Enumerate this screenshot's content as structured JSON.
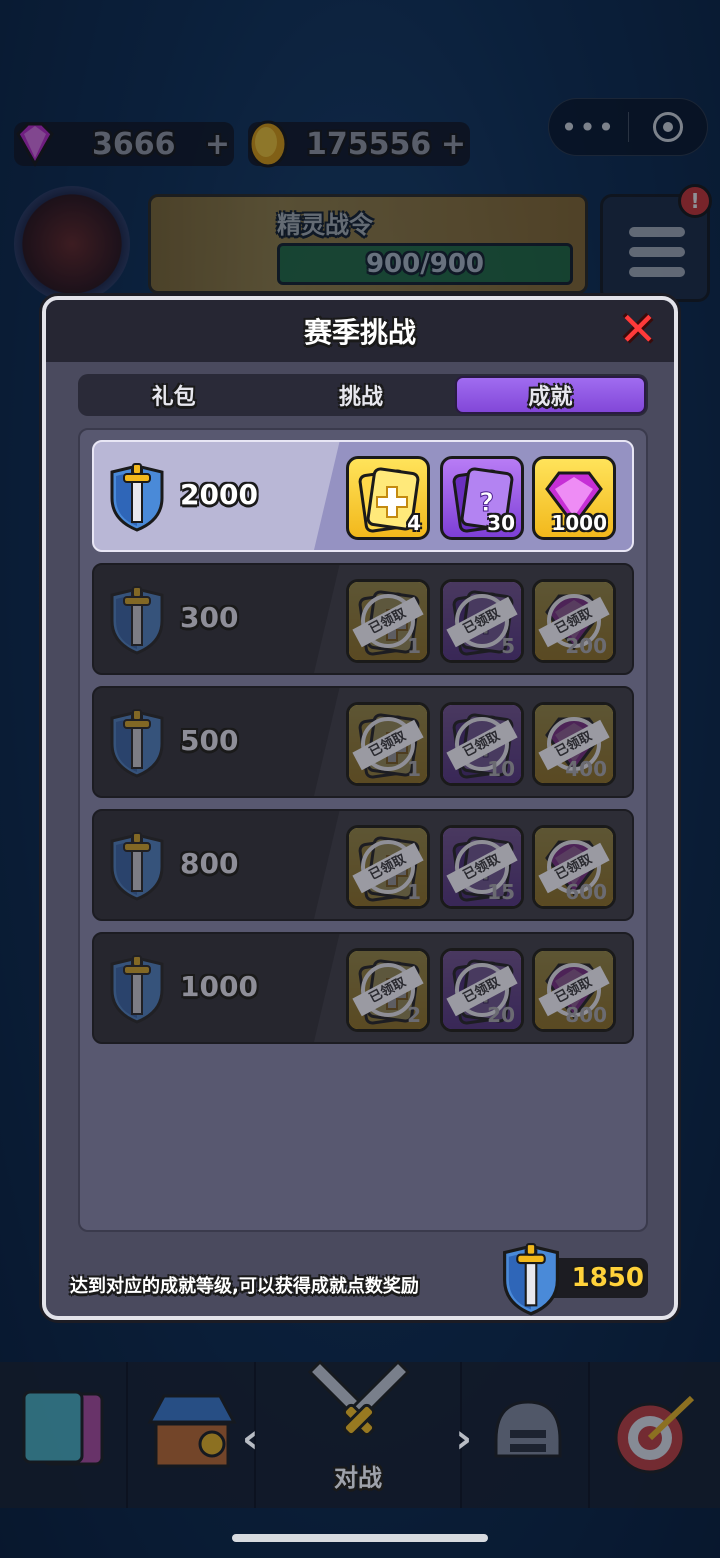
{
  "top_bar": {
    "gems": "3666",
    "gold": "175556",
    "plus": "+",
    "more_glyph": "•••"
  },
  "pass": {
    "title": "精灵战令",
    "progress_text": "900/900",
    "progress": 1.0
  },
  "menu": {
    "alert": "!"
  },
  "modal": {
    "title": "赛季挑战",
    "close_glyph": "✕",
    "tabs": [
      {
        "label": "礼包",
        "active": false
      },
      {
        "label": "挑战",
        "active": false
      },
      {
        "label": "成就",
        "active": true
      }
    ],
    "rows": [
      {
        "score": "2000",
        "claimed": false,
        "rewards": [
          {
            "type": "gold-card",
            "qty": "4"
          },
          {
            "type": "purple-card",
            "qty": "30"
          },
          {
            "type": "gem",
            "qty": "1000"
          }
        ]
      },
      {
        "score": "300",
        "claimed": true,
        "rewards": [
          {
            "type": "gold-card",
            "qty": "1"
          },
          {
            "type": "purple-card",
            "qty": "5"
          },
          {
            "type": "gem",
            "qty": "200"
          }
        ]
      },
      {
        "score": "500",
        "claimed": true,
        "rewards": [
          {
            "type": "gold-card",
            "qty": "1"
          },
          {
            "type": "purple-card",
            "qty": "10"
          },
          {
            "type": "gem",
            "qty": "400"
          }
        ]
      },
      {
        "score": "800",
        "claimed": true,
        "rewards": [
          {
            "type": "gold-card",
            "qty": "1"
          },
          {
            "type": "purple-card",
            "qty": "15"
          },
          {
            "type": "gem",
            "qty": "600"
          }
        ]
      },
      {
        "score": "1000",
        "claimed": true,
        "rewards": [
          {
            "type": "gold-card",
            "qty": "2"
          },
          {
            "type": "purple-card",
            "qty": "20"
          },
          {
            "type": "gem",
            "qty": "800"
          }
        ]
      }
    ],
    "claimed_label": "已领取",
    "footer_text": "达到对应的成就等级,可以获得成就点数奖励",
    "current_points": "1850"
  },
  "bottom_nav": {
    "battle_label": "对战",
    "prev_glyph": "‹",
    "next_glyph": "›"
  },
  "colors": {
    "accent_purple": "#8247d8",
    "close_red": "#ff3a3a",
    "score_yellow": "#ffd23a"
  }
}
